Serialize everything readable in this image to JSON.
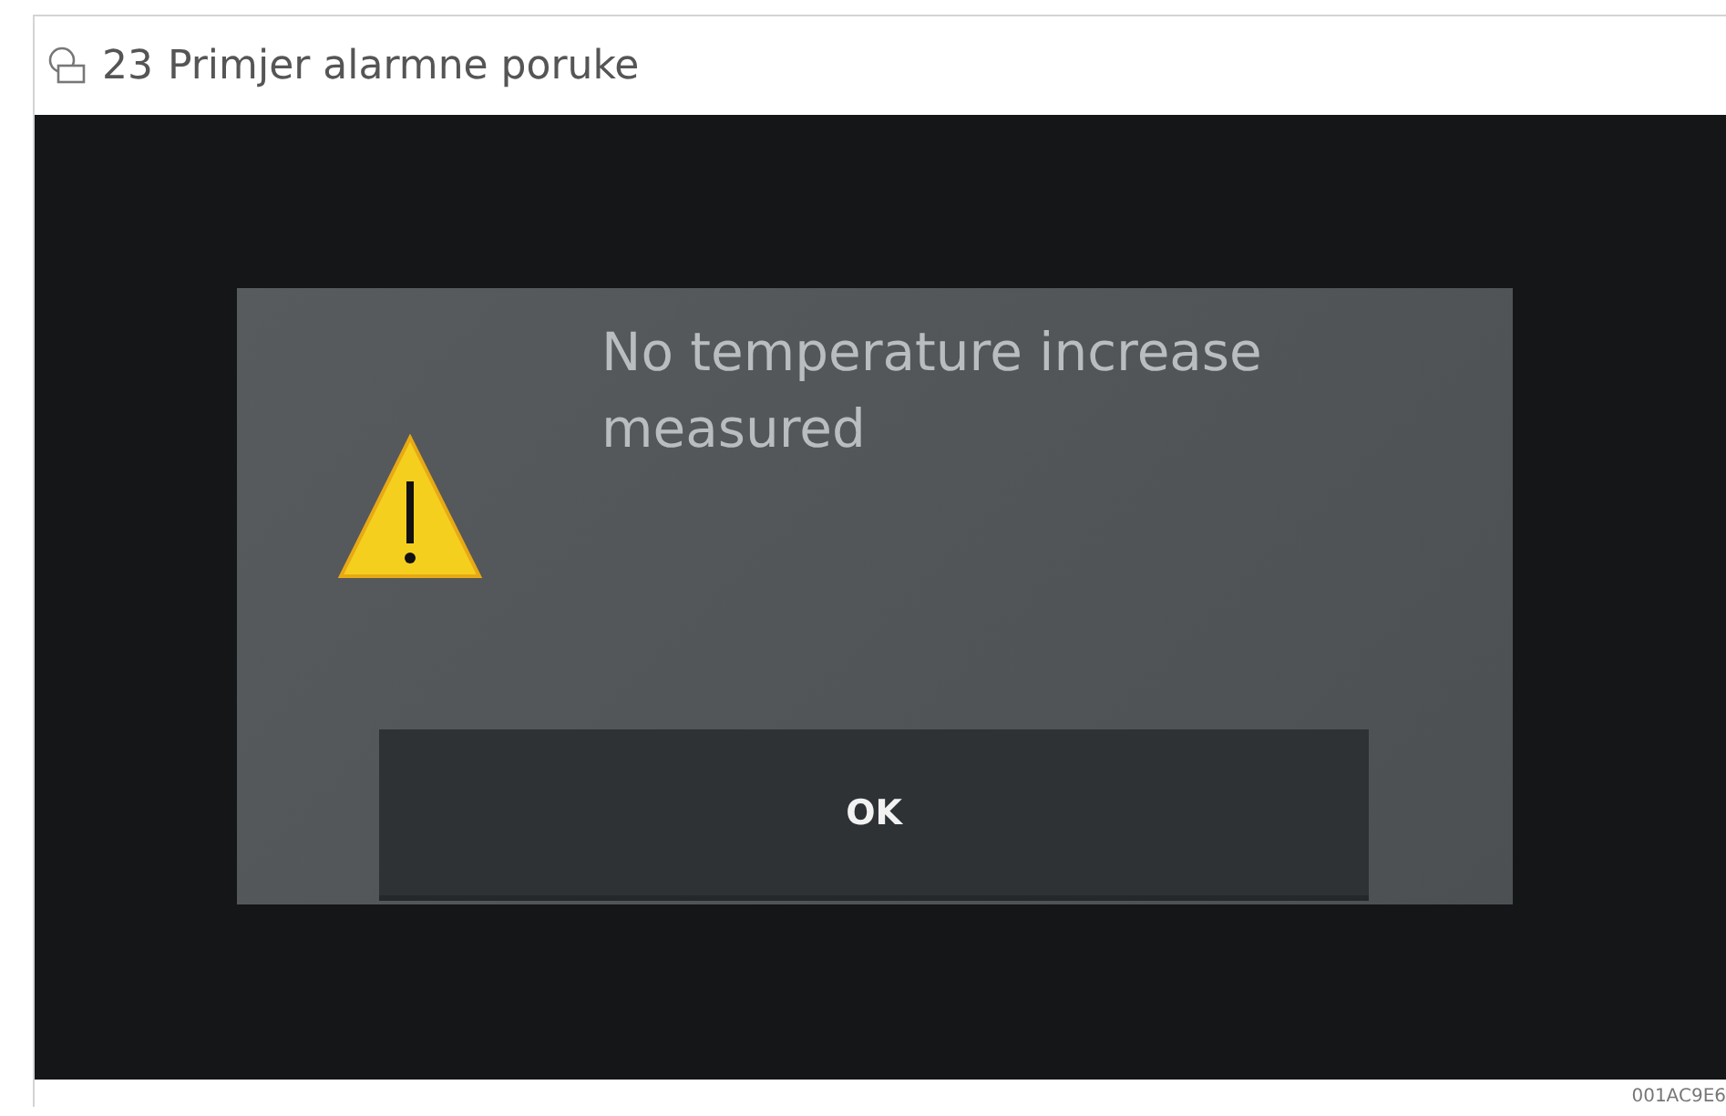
{
  "figure": {
    "number": "23",
    "title": "Primjer alarmne poruke",
    "code": "001AC9E6"
  },
  "dialog": {
    "message": "No temperature increase measured",
    "button": "OK"
  }
}
